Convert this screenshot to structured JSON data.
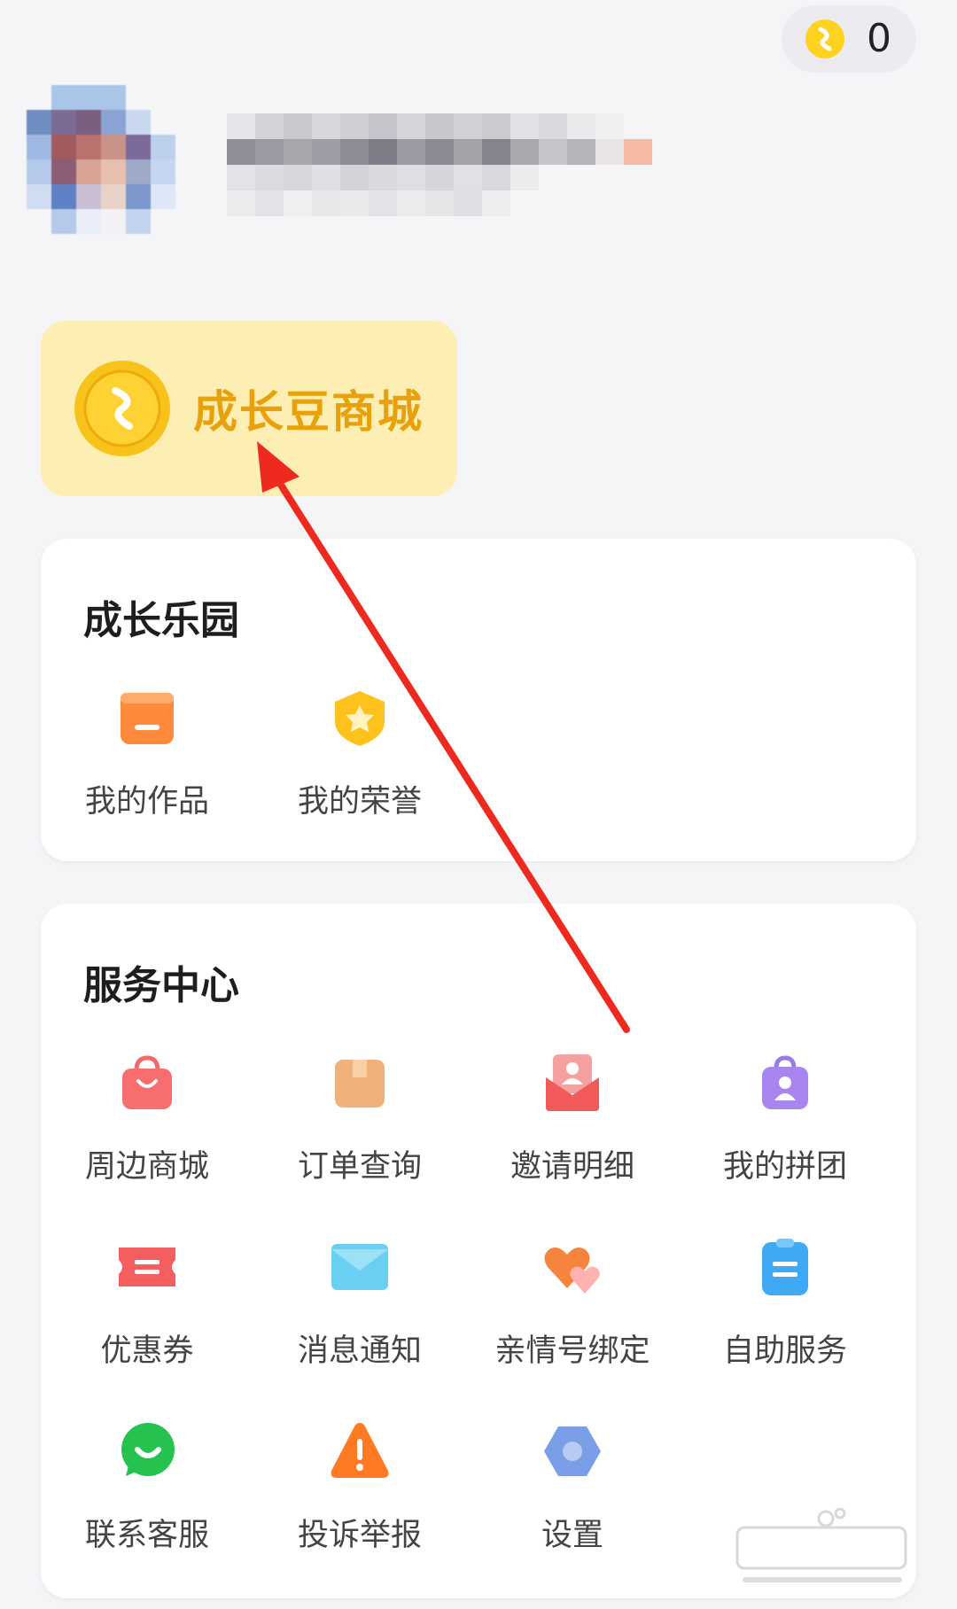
{
  "header": {
    "coin_count": "0"
  },
  "mall": {
    "title": "成长豆商城",
    "icon": "coin-icon"
  },
  "growth_park": {
    "title": "成长乐园",
    "items": [
      {
        "label": "我的作品",
        "icon": "works-box-icon"
      },
      {
        "label": "我的荣誉",
        "icon": "honor-badge-icon"
      }
    ]
  },
  "service_center": {
    "title": "服务中心",
    "items": [
      {
        "label": "周边商城",
        "icon": "shopping-bag-icon"
      },
      {
        "label": "订单查询",
        "icon": "package-box-icon"
      },
      {
        "label": "邀请明细",
        "icon": "invite-envelope-icon"
      },
      {
        "label": "我的拼团",
        "icon": "group-bag-icon"
      },
      {
        "label": "优惠券",
        "icon": "coupon-ticket-icon"
      },
      {
        "label": "消息通知",
        "icon": "mail-icon"
      },
      {
        "label": "亲情号绑定",
        "icon": "hearts-icon"
      },
      {
        "label": "自助服务",
        "icon": "clipboard-list-icon"
      },
      {
        "label": "联系客服",
        "icon": "chat-bubble-icon"
      },
      {
        "label": "投诉举报",
        "icon": "warning-triangle-icon"
      },
      {
        "label": "设置",
        "icon": "settings-hexagon-icon"
      }
    ]
  },
  "colors": {
    "accent_gold": "#e8a10a",
    "mall_bg": "#fdeeb4",
    "annotation_arrow": "#ee2a1f"
  }
}
